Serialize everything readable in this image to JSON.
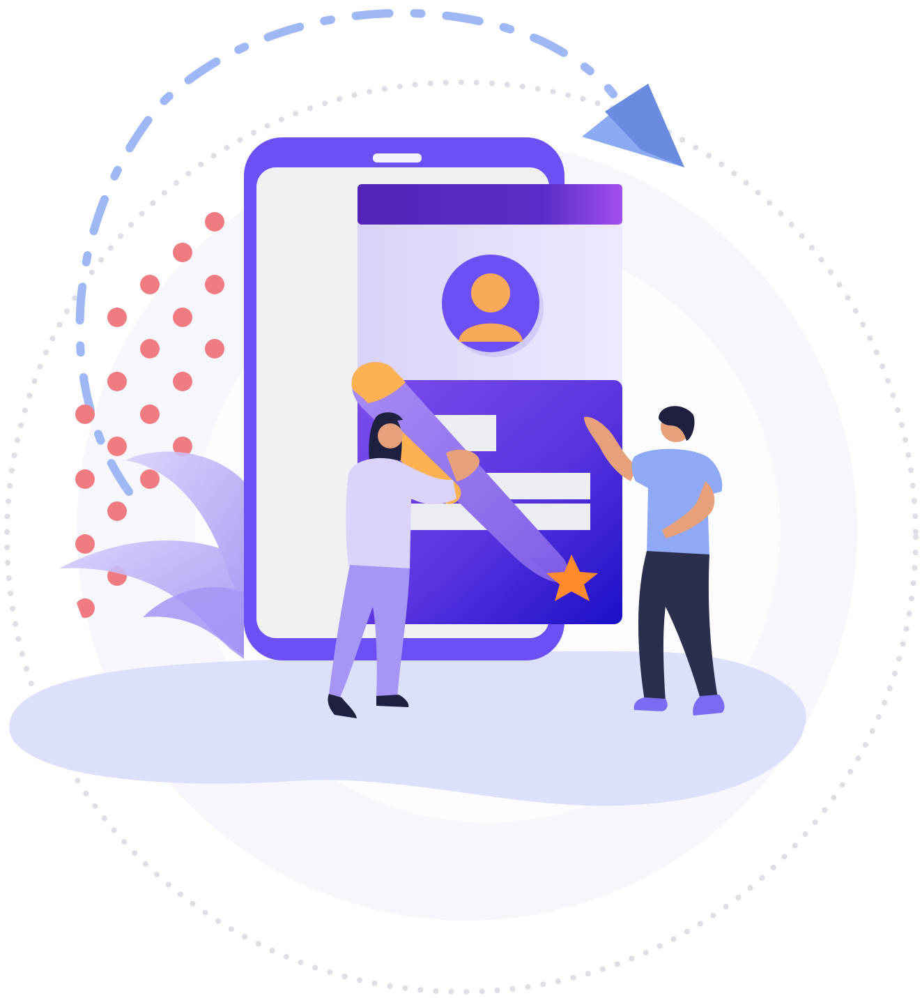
{
  "illustration": {
    "subject": "",
    "icons": [
      "paper-plane-icon",
      "user-avatar-icon",
      "pencil-icon",
      "star-icon"
    ]
  },
  "colors": {
    "phone_frame": "#6E4FF6",
    "phone_screen": "#F1F1F3",
    "card_header": "#5A2DC8",
    "card_header_accent": "#A24FEF",
    "card_body": "#DCD6FA",
    "form_panel": "#6A3FE6",
    "form_panel_dark": "#1B0FC7",
    "input_field": "#ECECF3",
    "avatar_ring": "#6E4FF6",
    "avatar_person": "#F8A95A",
    "pencil_body": "#9A7BF0",
    "pencil_cap": "#FCB252",
    "star": "#FF8A2B",
    "ground": "#DCE0FB",
    "halo": "#F6F7FC",
    "dots_pink": "#F17B83",
    "dashes_blue": "#9FB8F5",
    "dotted_ring": "#E2E3EA",
    "paper_plane": "#7FA1F0",
    "leaves": "#B9AEF6",
    "man_shirt": "#8FA9F7",
    "man_pants": "#2C2E4E",
    "man_skin": "#E7A17A",
    "woman_shirt": "#DCD3FB",
    "woman_pants": "#A595F5",
    "hair": "#1F2040"
  }
}
